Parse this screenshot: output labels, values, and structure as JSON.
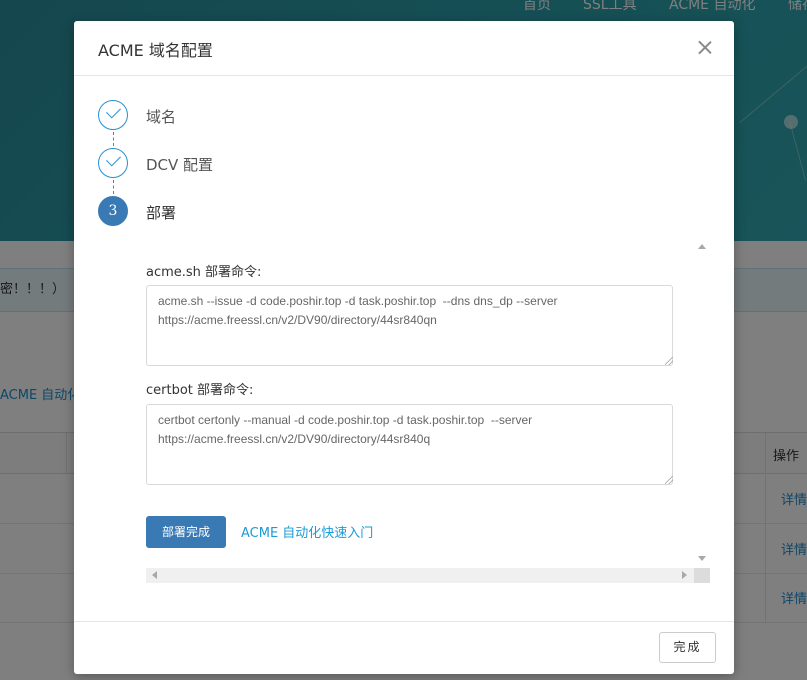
{
  "background": {
    "nav": [
      "首页",
      "SSL工具",
      "ACME 自动化",
      "储存"
    ],
    "alert_text": "密！！！）",
    "acme_link": "ACME 自动化",
    "table": {
      "action_header": "操作",
      "rows": [
        "详情",
        "详情",
        "详情"
      ]
    }
  },
  "modal": {
    "title": "ACME 域名配置",
    "steps": [
      {
        "label": "域名",
        "status": "done"
      },
      {
        "label": "DCV 配置",
        "status": "done"
      },
      {
        "number": "3",
        "label": "部署",
        "status": "active"
      }
    ],
    "acme_sh_label": "acme.sh 部署命令:",
    "acme_sh_command": "acme.sh --issue -d code.poshir.top -d task.poshir.top  --dns dns_dp --server https://acme.freessl.cn/v2/DV90/directory/44sr840qn",
    "certbot_label": "certbot 部署命令:",
    "certbot_command": "certbot certonly --manual -d code.poshir.top -d task.poshir.top  --server https://acme.freessl.cn/v2/DV90/directory/44sr840q",
    "deploy_done_button": "部署完成",
    "quickstart_link": "ACME 自动化快速入门",
    "finish_button": "完成"
  },
  "colors": {
    "primary": "#3a7ab4",
    "link": "#1a9bd6",
    "header_bg": "#2a9aa5"
  }
}
